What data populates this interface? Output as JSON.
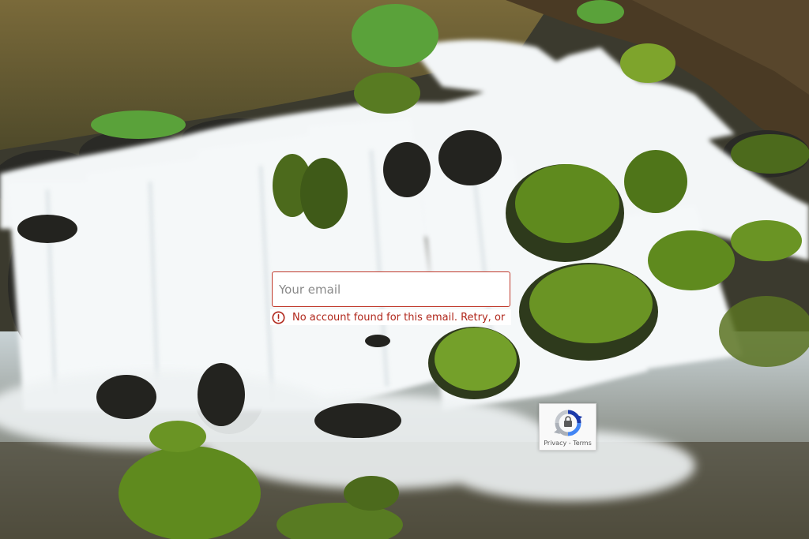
{
  "background": {
    "image": "waterfall-photo"
  },
  "email_field": {
    "value": "",
    "placeholder": "Your email"
  },
  "error": {
    "icon": "exclamation-circle-icon",
    "message": "No account found for this email. Retry, or",
    "color": "#b0261a"
  },
  "recaptcha": {
    "icon": "recaptcha-logo-icon",
    "privacy_label": "Privacy",
    "separator": " - ",
    "terms_label": "Terms"
  },
  "colors": {
    "input_border": "#c0392b",
    "water": "#f2f5f6",
    "moss": "#5f8a1e",
    "rock": "#2f2f2a",
    "pool": "#6b5f35"
  }
}
